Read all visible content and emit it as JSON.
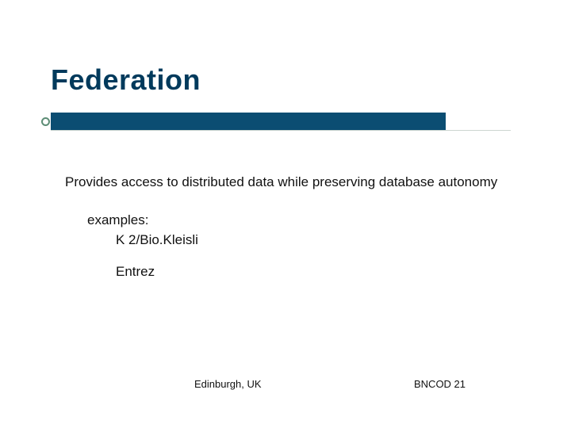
{
  "slide": {
    "title": "Federation",
    "body": "Provides access to distributed data while preserving database autonomy",
    "examples_label": "examples:",
    "examples": [
      "K 2/Bio.Kleisli",
      "Entrez"
    ],
    "footer": {
      "left": "Edinburgh, UK",
      "right": "BNCOD 21"
    },
    "colors": {
      "title_text": "#003a5c",
      "bar": "#0b4d72",
      "bullet_ring": "#5d8d76"
    }
  }
}
